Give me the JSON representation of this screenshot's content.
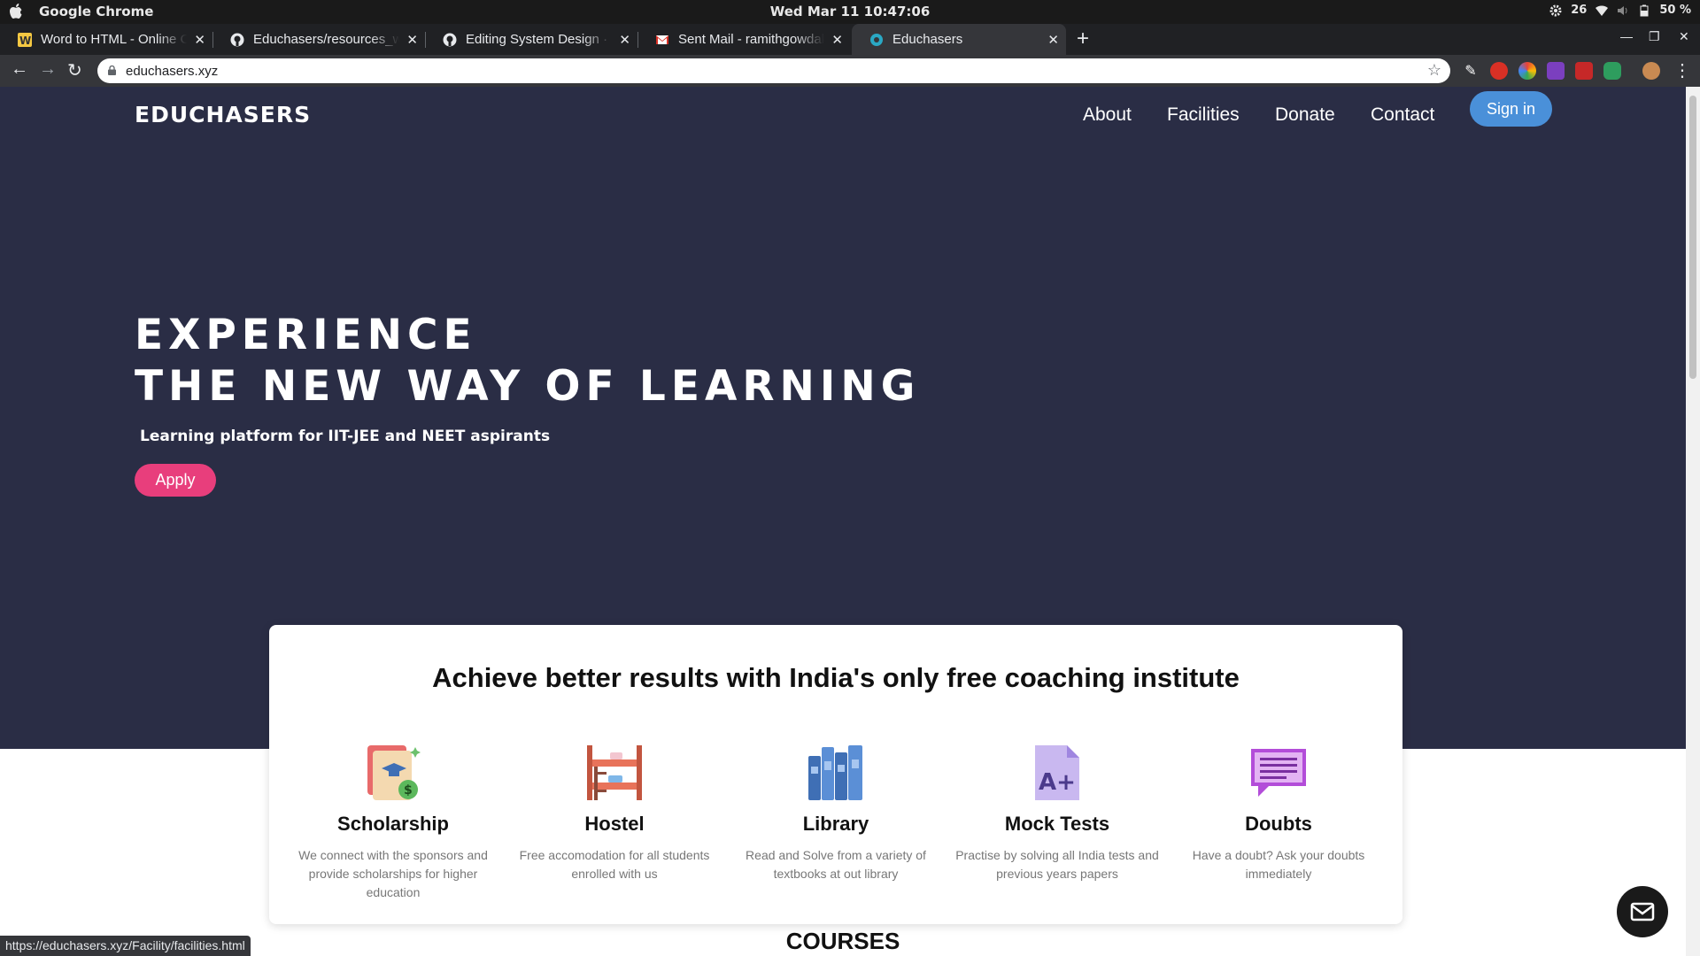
{
  "os": {
    "app_name": "Google Chrome",
    "clock": "Wed Mar 11  10:47:06",
    "tray_number": "26",
    "battery": "50 %"
  },
  "tabs": [
    {
      "title": "Word to HTML - Online Co"
    },
    {
      "title": "Educhasers/resources_wi"
    },
    {
      "title": "Editing System Design · ra"
    },
    {
      "title": "Sent Mail - ramithgowdak"
    },
    {
      "title": "Educhasers"
    }
  ],
  "address": {
    "url": "educhasers.xyz"
  },
  "site": {
    "logo": "EDUCHASERS",
    "nav": {
      "about": "About",
      "facilities": "Facilities",
      "donate": "Donate",
      "contact": "Contact"
    },
    "signin": "Sign in",
    "hero_line1": "EXPERIENCE",
    "hero_line2": "THE NEW WAY OF LEARNING",
    "hero_sub": "Learning platform for IIT-JEE and NEET aspirants",
    "apply": "Apply",
    "card_title": "Achieve better results with India's only free coaching institute",
    "features": [
      {
        "name": "Scholarship",
        "desc": "We connect with the sponsors and provide scholarships for higher education"
      },
      {
        "name": "Hostel",
        "desc": "Free accomodation for all students enrolled with us"
      },
      {
        "name": "Library",
        "desc": "Read and Solve from a variety of textbooks at out library"
      },
      {
        "name": "Mock Tests",
        "desc": "Practise by solving all India tests and previous years papers"
      },
      {
        "name": "Doubts",
        "desc": "Have a doubt? Ask your doubts immediately"
      }
    ],
    "courses": "COURSES"
  },
  "status_bar": {
    "url": "https://educhasers.xyz/Facility/facilities.html"
  },
  "colors": {
    "hero_bg": "#2a2d45",
    "apply": "#e83e7c",
    "signin": "#4a90d9"
  }
}
